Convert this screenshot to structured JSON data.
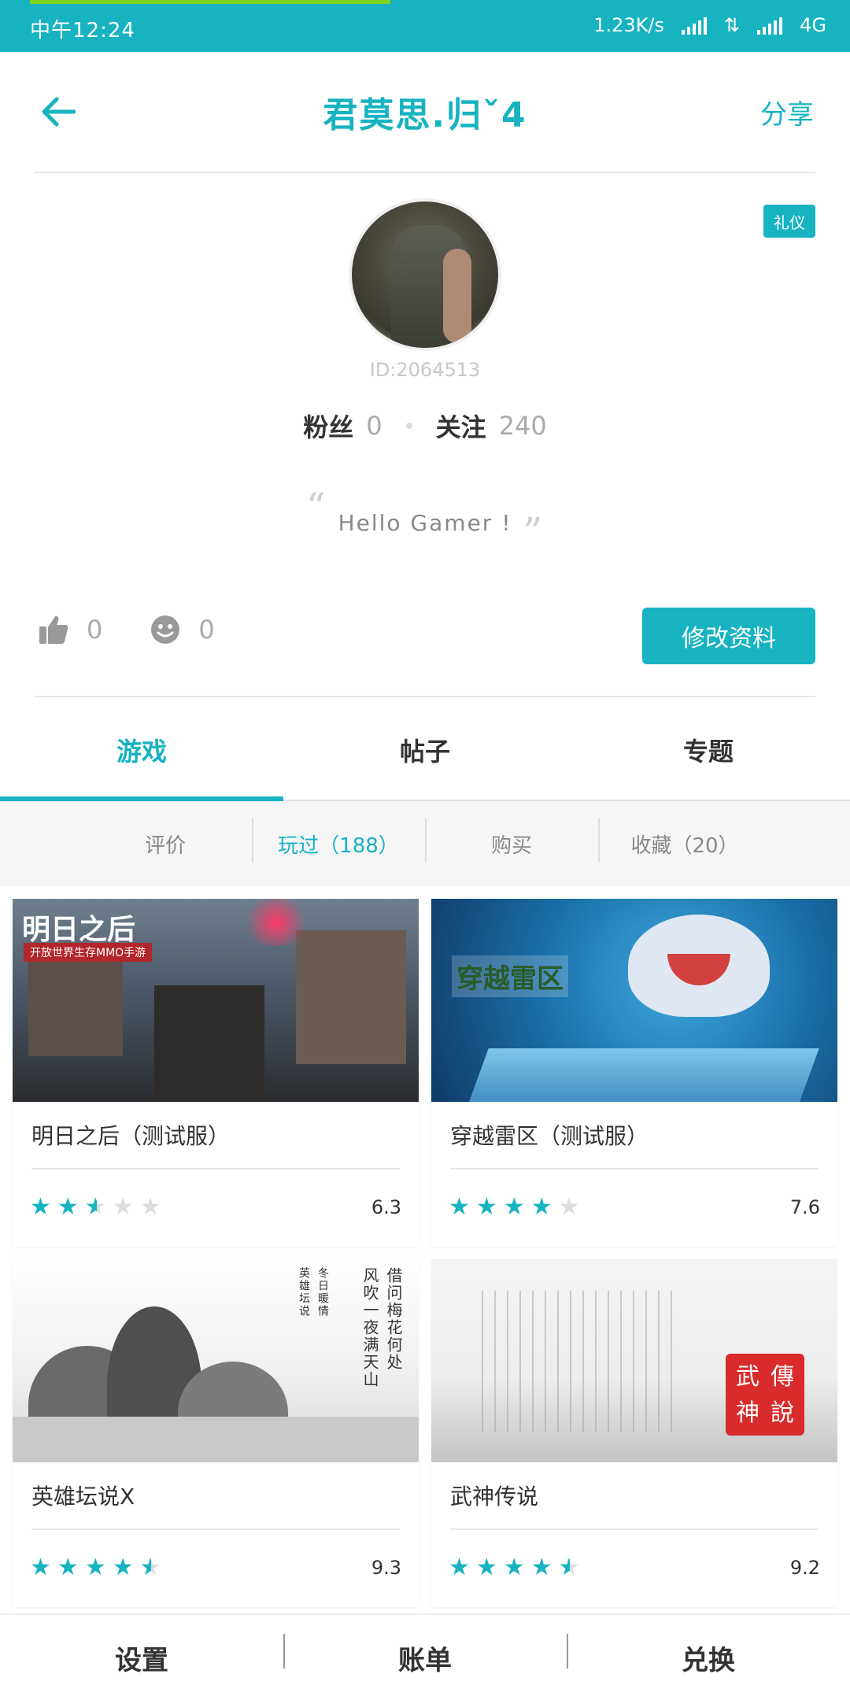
{
  "status_bar": {
    "time": "中午12:24",
    "network_speed": "1.23K/s",
    "network_type": "4G"
  },
  "header": {
    "back_icon": "arrow-left-icon",
    "title": "君莫思.归ˇ4",
    "share_label": "分享"
  },
  "profile": {
    "badge_label": "礼仪",
    "user_id": "ID:2064513",
    "fans_label": "粉丝",
    "fans_count": "0",
    "following_label": "关注",
    "following_count": "240",
    "signature": "Hello Gamer !",
    "likes_count": "0",
    "smiles_count": "0",
    "edit_button_label": "修改资料"
  },
  "tabs": [
    {
      "label": "游戏",
      "active": true
    },
    {
      "label": "帖子",
      "active": false
    },
    {
      "label": "专题",
      "active": false
    }
  ],
  "subtabs": [
    {
      "label": "评价",
      "active": false
    },
    {
      "label": "玩过（188）",
      "active": true
    },
    {
      "label": "购买",
      "active": false
    },
    {
      "label": "收藏（20）",
      "active": false
    }
  ],
  "games": [
    {
      "title": "明日之后（测试服）",
      "rating": 2.5,
      "score": "6.3",
      "art_text": "明日之后",
      "art_subtext": "开放世界生存MMO手游"
    },
    {
      "title": "穿越雷区（测试服）",
      "rating": 4,
      "score": "7.6",
      "art_text": "穿越雷区"
    },
    {
      "title": "英雄坛说X",
      "rating": 4.5,
      "score": "9.3",
      "art_poem_1": "借问梅花何处",
      "art_poem_2": "风吹一夜满天山",
      "art_poem_3": "冬日暖情",
      "art_poem_4": "英雄坛说"
    },
    {
      "title": "武神传说",
      "rating": 4.5,
      "score": "9.2",
      "art_seal": [
        "武",
        "傳",
        "神",
        "說"
      ]
    }
  ],
  "bottom_bar": {
    "settings_label": "设置",
    "bill_label": "账单",
    "redeem_label": "兑换"
  },
  "colors": {
    "accent": "#17b3c1",
    "progress": "#7ed321"
  }
}
